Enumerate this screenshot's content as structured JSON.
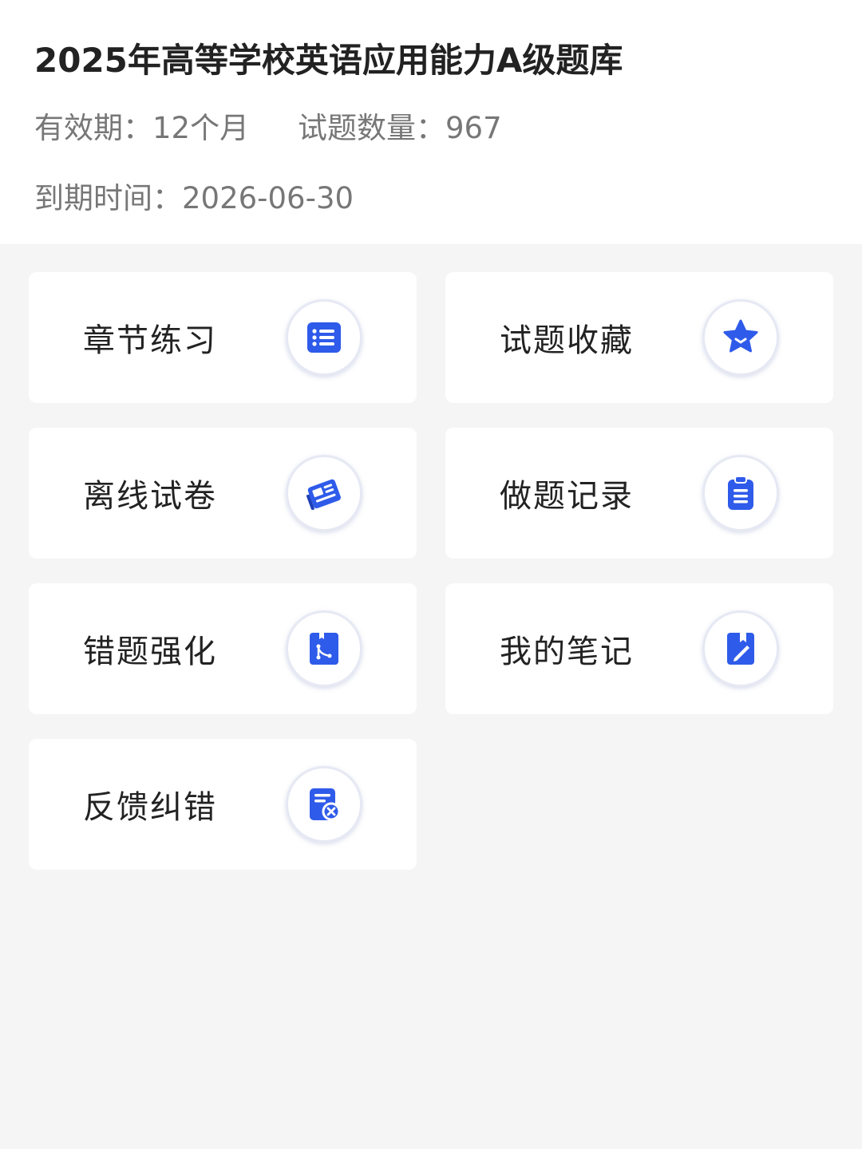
{
  "header": {
    "title": "2025年高等学校英语应用能力A级题库",
    "validity_label": "有效期：",
    "validity_value": "12个月",
    "count_label": "试题数量：",
    "count_value": "967",
    "expiry_label": "到期时间：",
    "expiry_value": "2026-06-30"
  },
  "accent_color": "#2f5bea",
  "menu": [
    {
      "label": "章节练习",
      "icon": "list-icon"
    },
    {
      "label": "试题收藏",
      "icon": "star-icon"
    },
    {
      "label": "离线试卷",
      "icon": "newspaper-icon"
    },
    {
      "label": "做题记录",
      "icon": "clipboard-icon"
    },
    {
      "label": "错题强化",
      "icon": "bookmark-tree-icon"
    },
    {
      "label": "我的笔记",
      "icon": "notebook-pen-icon"
    },
    {
      "label": "反馈纠错",
      "icon": "report-error-icon"
    }
  ]
}
